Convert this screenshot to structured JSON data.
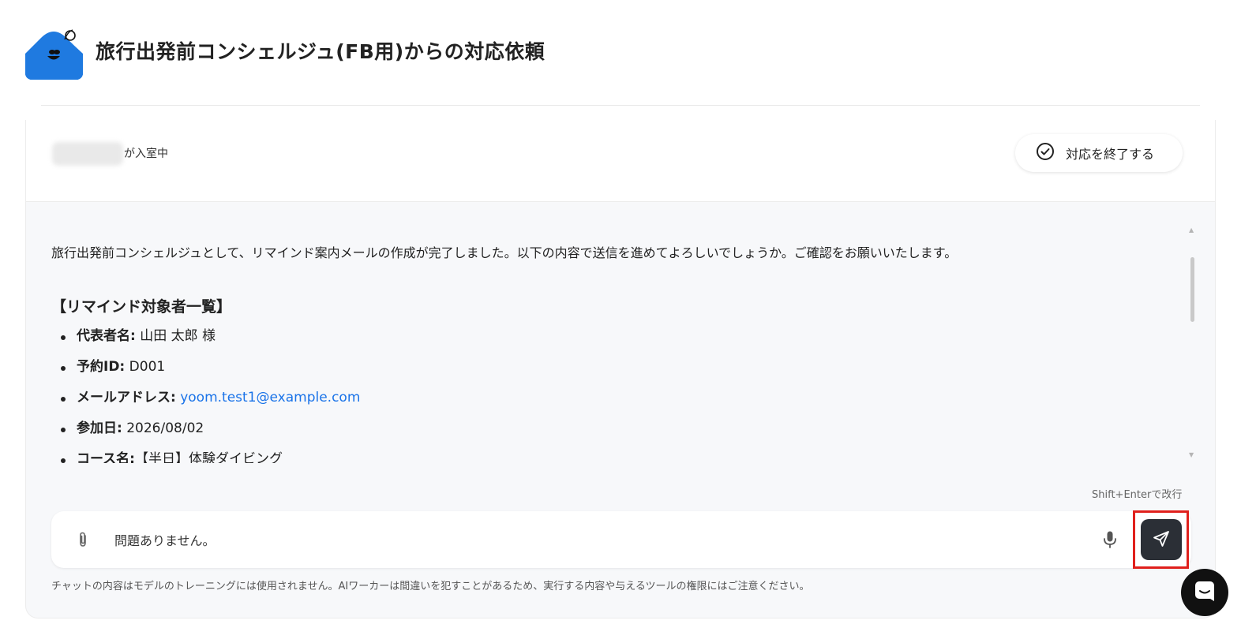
{
  "header": {
    "title": "旅行出発前コンシェルジュ(FB用)からの対応依頼",
    "logo_icon": "mascot-logo-icon"
  },
  "room": {
    "presence_text": "が入室中",
    "end_button_label": "対応を終了する",
    "end_icon": "check-circle-icon"
  },
  "message": {
    "intro": "旅行出発前コンシェルジュとして、リマインド案内メールの作成が完了しました。以下の内容で送信を進めてよろしいでしょうか。ご確認をお願いいたします。",
    "heading": "【リマインド対象者一覧】",
    "items": [
      {
        "key": "代表者名:",
        "value": "山田 太郎 様"
      },
      {
        "key": "予約ID:",
        "value": "D001"
      },
      {
        "key": "メールアドレス:",
        "value": "yoom.test1@example.com"
      },
      {
        "key": "参加日:",
        "value": "2026/08/02"
      },
      {
        "key": "コース名:",
        "value": "【半日】体験ダイビング"
      }
    ]
  },
  "composer": {
    "hint": "Shift+Enterで改行",
    "input_value": "問題ありません。",
    "attach_icon": "paperclip-icon",
    "mic_icon": "microphone-icon",
    "send_icon": "send-icon",
    "disclaimer": "チャットの内容はモデルのトレーニングには使用されません。AIワーカーは間違いを犯すことがあるため、実行する内容や与えるツールの権限にはご注意ください。"
  },
  "colors": {
    "accent_blue": "#1f7ae0",
    "link": "#1a73e8",
    "send_bg": "#2b2f36",
    "highlight": "#e0201c"
  }
}
